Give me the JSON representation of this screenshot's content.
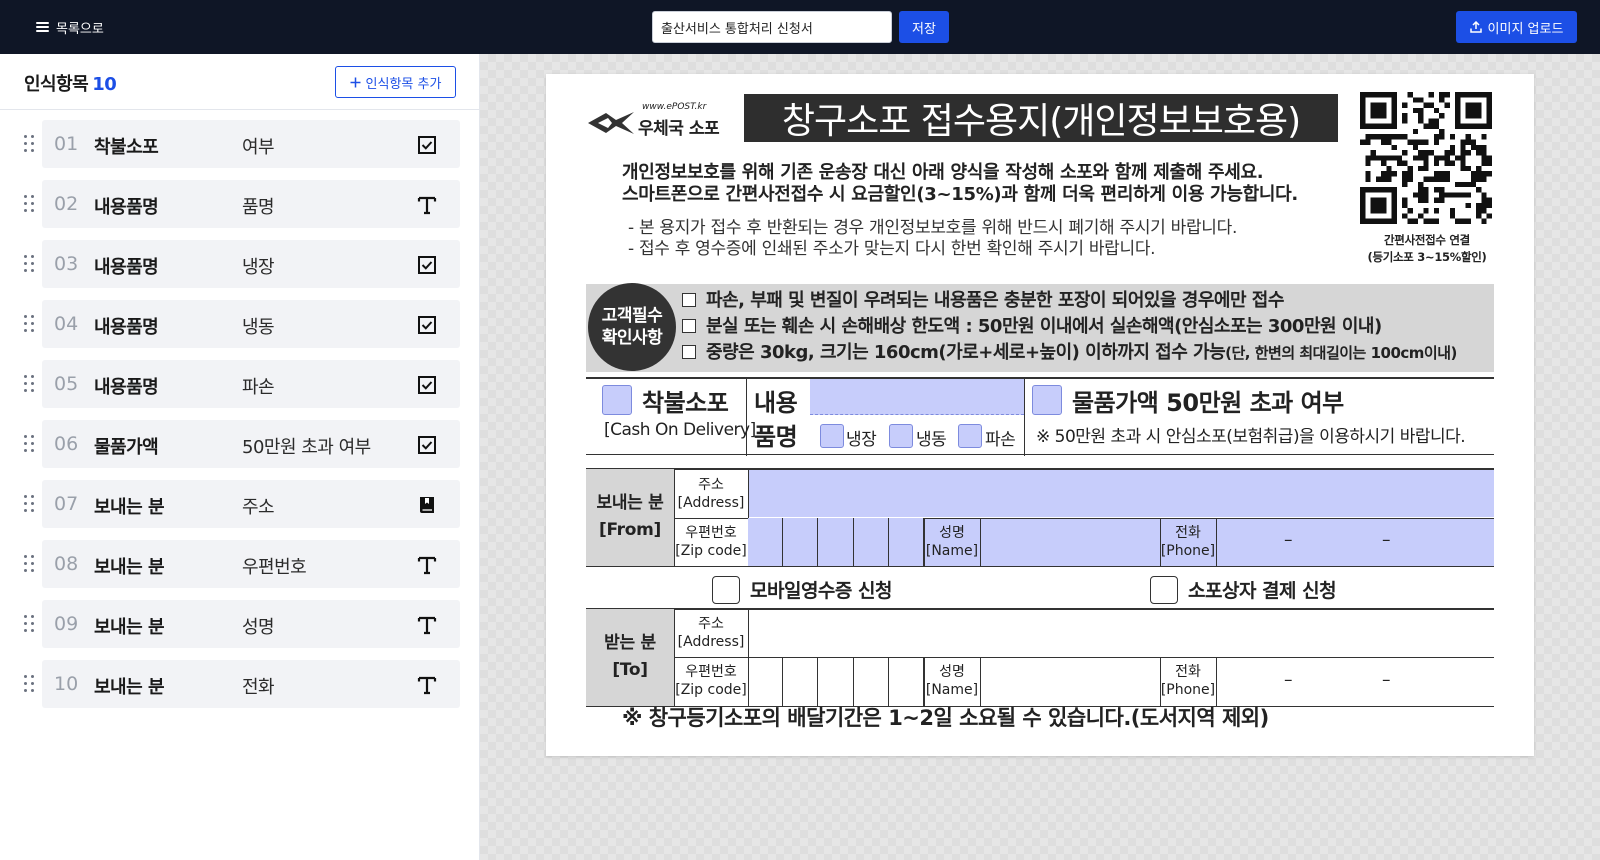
{
  "topbar": {
    "back_label": "목록으로",
    "title_value": "출산서비스 통합처리 신청서",
    "save_label": "저장",
    "upload_label": "이미지 업로드"
  },
  "panel": {
    "title": "인식항목",
    "count": "10",
    "add_label": "인식항목 추가"
  },
  "items": [
    {
      "num": "01",
      "category": "착불소포",
      "label": "여부",
      "type_icon": "checkbox-icon"
    },
    {
      "num": "02",
      "category": "내용품명",
      "label": "품명",
      "type_icon": "text-icon"
    },
    {
      "num": "03",
      "category": "내용품명",
      "label": "냉장",
      "type_icon": "checkbox-icon"
    },
    {
      "num": "04",
      "category": "내용품명",
      "label": "냉동",
      "type_icon": "checkbox-icon"
    },
    {
      "num": "05",
      "category": "내용품명",
      "label": "파손",
      "type_icon": "checkbox-icon"
    },
    {
      "num": "06",
      "category": "물품가액",
      "label": "50만원 초과 여부",
      "type_icon": "checkbox-icon"
    },
    {
      "num": "07",
      "category": "보내는 분",
      "label": "주소",
      "type_icon": "book-icon"
    },
    {
      "num": "08",
      "category": "보내는 분",
      "label": "우편번호",
      "type_icon": "text-icon"
    },
    {
      "num": "09",
      "category": "보내는 분",
      "label": "성명",
      "type_icon": "text-icon"
    },
    {
      "num": "10",
      "category": "보내는 분",
      "label": "전화",
      "type_icon": "text-icon"
    }
  ],
  "form": {
    "logo_url": "www.ePOST.kr",
    "logo_name": "우체국 소포",
    "heading": "창구소포 접수용지(개인정보보호용)",
    "intro_1": "개인정보보호를 위해 기존 운송장 대신 아래 양식을 작성해 소포와 함께 제출해 주세요.",
    "intro_2": "스마트폰으로 간편사전접수 시 요금할인(3~15%)과 함께 더욱 편리하게 이용 가능합니다.",
    "note_1": "- 본 용지가 접수 후 반환되는 경우 개인정보보호를 위해 반드시 폐기해 주시기 바랍니다.",
    "note_2": "- 접수 후 영수증에 인쇄된 주소가 맞는지 다시 한번 확인해 주시기 바랍니다.",
    "qr_caption_1": "간편사전접수 연결",
    "qr_caption_2": "(등기소포 3~15%할인)",
    "req_circle_1": "고객필수",
    "req_circle_2": "확인사항",
    "req_1": "파손, 부패 및 변질이 우려되는 내용품은 충분한 포장이 되어있을 경우에만 접수",
    "req_2": "분실 또는 훼손 시 손해배상 한도액 : 50만원 이내에서 실손해액(안심소포는 300만원 이내)",
    "req_3": "중량은 30kg, 크기는 160cm(가로+세로+높이) 이하까지 접수 가능",
    "req_3_small": "(단, 한변의 최대길이는 100cm이내)",
    "cod_title": "착불소포",
    "cod_sub": "[Cash On Delivery]",
    "contents_1": "내용",
    "contents_2": "품명",
    "opt_fridge": "냉장",
    "opt_frozen": "냉동",
    "opt_fragile": "파손",
    "value_title": "물품가액 50만원 초과 여부",
    "value_note": "※ 50만원 초과 시 안심소포(보험취급)을 이용하시기 바랍니다.",
    "from_1": "보내는 분",
    "from_2": "[From]",
    "to_1": "받는 분",
    "to_2": "[To]",
    "addr_1": "주소",
    "addr_2": "[Address]",
    "zip_1": "우편번호",
    "zip_2": "[Zip code]",
    "name_1": "성명",
    "name_2": "[Name]",
    "phone_1": "전화",
    "phone_2": "[Phone]",
    "dash": "–",
    "mobile_receipt": "모바일영수증 신청",
    "pay_request": "소포상자 결제 신청",
    "footer": "※ 창구등기소포의 배달기간은 1~2일 소요될 수 있습니다.(도서지역 제외)"
  }
}
